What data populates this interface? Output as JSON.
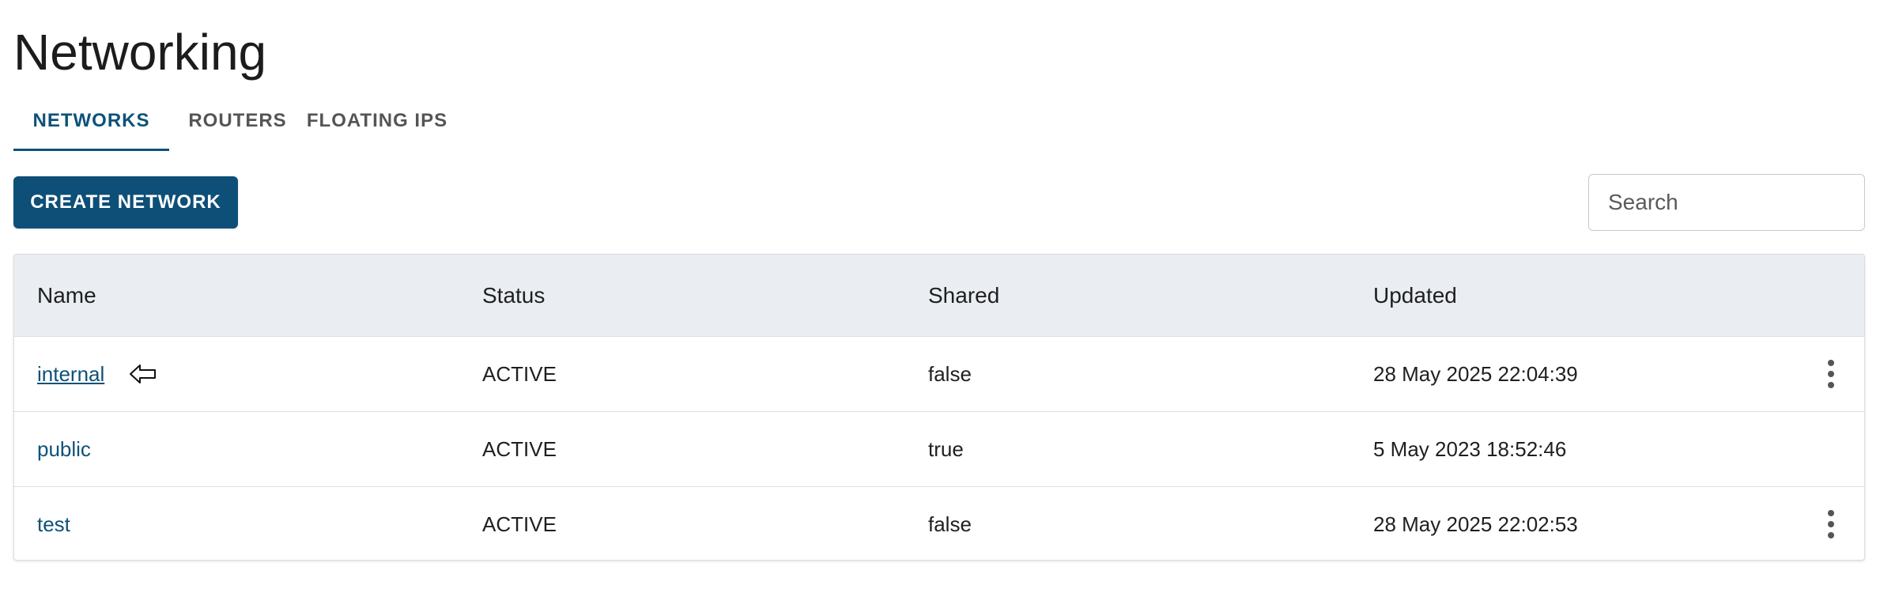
{
  "page": {
    "title": "Networking"
  },
  "tabs": [
    {
      "label": "NETWORKS",
      "active": true
    },
    {
      "label": "ROUTERS",
      "active": false
    },
    {
      "label": "FLOATING IPS",
      "active": false
    }
  ],
  "toolbar": {
    "create_label": "CREATE NETWORK",
    "search_placeholder": "Search",
    "search_value": ""
  },
  "table": {
    "columns": [
      "Name",
      "Status",
      "Shared",
      "Updated"
    ],
    "rows": [
      {
        "name": "internal",
        "status": "ACTIVE",
        "shared": "false",
        "updated": "28 May 2025 22:04:39",
        "has_menu": true
      },
      {
        "name": "public",
        "status": "ACTIVE",
        "shared": "true",
        "updated": "5 May 2023 18:52:46",
        "has_menu": false
      },
      {
        "name": "test",
        "status": "ACTIVE",
        "shared": "false",
        "updated": "28 May 2025 22:02:53",
        "has_menu": true
      }
    ]
  },
  "colors": {
    "accent": "#0d5279",
    "button_bg": "#0d4f77",
    "header_bg": "#eaeef2"
  },
  "icons": {
    "row_menu": "more-vert-icon",
    "pointer": "hand-pointer-icon"
  }
}
